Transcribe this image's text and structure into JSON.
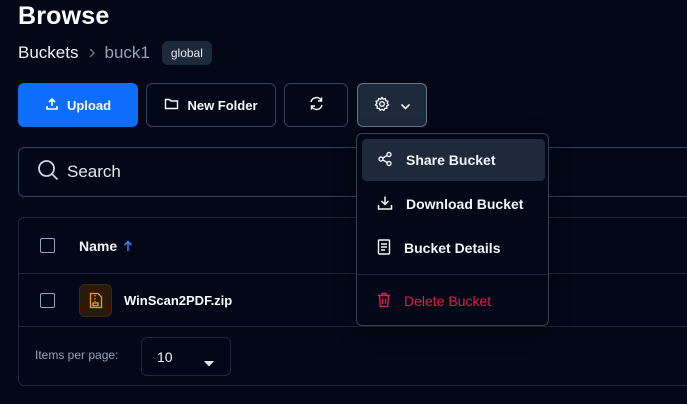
{
  "header": {
    "title": "Browse"
  },
  "breadcrumb": {
    "root": "Buckets",
    "current": "buck1",
    "badge": "global"
  },
  "toolbar": {
    "upload_label": "Upload",
    "new_folder_label": "New Folder",
    "icons": [
      "upload-icon",
      "folder-icon",
      "refresh-icon",
      "gear-icon",
      "chevron-down-icon"
    ]
  },
  "search": {
    "placeholder": "Search"
  },
  "table": {
    "columns": [
      {
        "label": "Name",
        "sort": "ascending"
      }
    ],
    "rows": [
      {
        "name": "WinScan2PDF.zip",
        "icon": "zip-file-icon"
      }
    ]
  },
  "pagination": {
    "label": "Items per page:",
    "value": "10"
  },
  "menu": {
    "items": [
      {
        "label": "Share Bucket",
        "icon": "share-icon"
      },
      {
        "label": "Download Bucket",
        "icon": "download-icon"
      },
      {
        "label": "Bucket Details",
        "icon": "document-icon"
      },
      {
        "label": "Delete Bucket",
        "icon": "trash-icon",
        "color": "#e11d48"
      }
    ]
  },
  "colors": {
    "background": "#020817",
    "accent": "#0d6efd",
    "danger": "#e11d48",
    "file_icon": "#f59e0b"
  }
}
